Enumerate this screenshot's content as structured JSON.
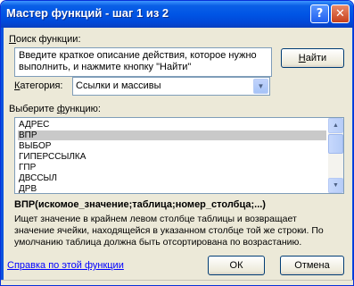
{
  "window": {
    "title": "Мастер функций - шаг 1 из 2",
    "help_glyph": "?",
    "close_glyph": "✕"
  },
  "search": {
    "label_prefix": "",
    "label_hotkey": "П",
    "label_rest": "оиск функции:",
    "text": "Введите краткое описание действия, которое нужно\nвыполнить, и нажмите кнопку \"Найти\"",
    "find_button": "Найти",
    "find_hotkey": "Н",
    "find_rest": "айти"
  },
  "category": {
    "label_hotkey": "К",
    "label_rest": "атегория:",
    "value": "Ссылки и массивы"
  },
  "functions": {
    "label_prefix": "Выберите ",
    "label_hotkey": "ф",
    "label_rest": "ункцию:",
    "items": [
      "АДРЕС",
      "ВПР",
      "ВЫБОР",
      "ГИПЕРССЫЛКА",
      "ГПР",
      "ДВССЫЛ",
      "ДРВ"
    ],
    "selected_index": 1
  },
  "details": {
    "signature": "ВПР(искомое_значение;таблица;номер_столбца;...)",
    "description": "Ищет значение в крайнем левом столбце таблицы и возвращает\nзначение ячейки, находящейся в указанном столбце той же строки. По\nумолчанию таблица должна быть отсортирована по возрастанию."
  },
  "footer": {
    "help_link": "Справка по этой функции",
    "ok": "ОК",
    "cancel": "Отмена"
  }
}
